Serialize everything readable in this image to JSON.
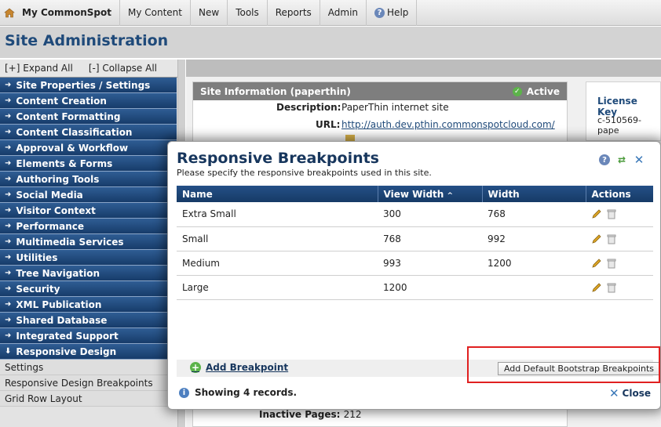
{
  "topbar": {
    "brand": "My CommonSpot",
    "items": [
      "My Content",
      "New",
      "Tools",
      "Reports",
      "Admin"
    ],
    "help": "Help"
  },
  "page": {
    "title": "Site Administration"
  },
  "sidebar": {
    "expand_all": "[+] Expand All",
    "collapse_all": "[-] Collapse All",
    "sections": [
      "Site Properties / Settings",
      "Content Creation",
      "Content Formatting",
      "Content Classification",
      "Approval & Workflow",
      "Elements & Forms",
      "Authoring Tools",
      "Social Media",
      "Visitor Context",
      "Performance",
      "Multimedia Services",
      "Utilities",
      "Tree Navigation",
      "Security",
      "XML Publication",
      "Shared Database",
      "Integrated Support"
    ],
    "expanded_section": "Responsive Design",
    "sub_items": [
      "Settings",
      "Responsive Design Breakpoints",
      "Grid Row Layout"
    ]
  },
  "site_info": {
    "header": "Site Information (paperthin)",
    "status": "Active",
    "description_label": "Description:",
    "description_value": "PaperThin internet site",
    "url_label": "URL:",
    "url_value": "http://auth.dev.pthin.commonspotcloud.com/",
    "inactive_label": "Inactive Pages:",
    "inactive_value": "212"
  },
  "license": {
    "title": "License Key",
    "value": "c-510569-pape"
  },
  "dialog": {
    "title": "Responsive Breakpoints",
    "subtitle": "Please specify the responsive breakpoints used in this site.",
    "columns": [
      "Name",
      "View Width",
      "Width",
      "Actions"
    ],
    "rows": [
      {
        "name": "Extra Small",
        "view_width": "300",
        "width": "768"
      },
      {
        "name": "Small",
        "view_width": "768",
        "width": "992"
      },
      {
        "name": "Medium",
        "view_width": "993",
        "width": "1200"
      },
      {
        "name": "Large",
        "view_width": "1200",
        "width": ""
      }
    ],
    "add_breakpoint": "Add Breakpoint",
    "bootstrap_button": "Add Default Bootstrap Breakpoints",
    "status": "Showing 4 records.",
    "close": "Close"
  },
  "colors": {
    "nav_blue": "#1f4a7a",
    "highlight": "#e02020",
    "add_green": "#5cb34a"
  }
}
